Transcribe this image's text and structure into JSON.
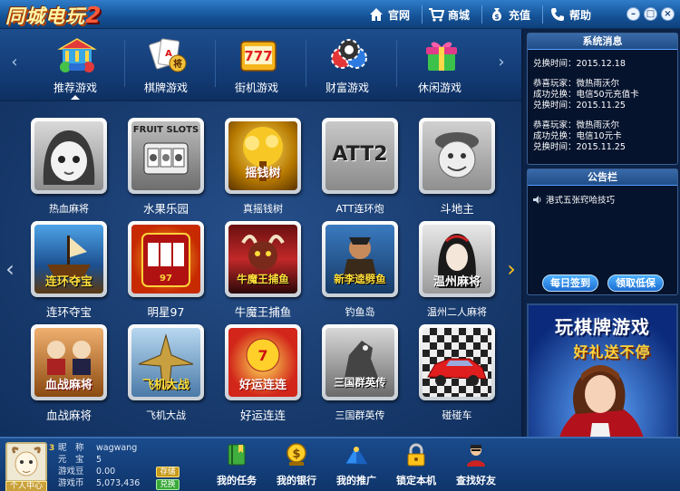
{
  "app": {
    "logo_text": "同城电玩",
    "logo_number": "2"
  },
  "titlebar": {
    "links": [
      {
        "label": "官网",
        "icon": "home-icon"
      },
      {
        "label": "商城",
        "icon": "shopping-cart-icon"
      },
      {
        "label": "充值",
        "icon": "money-bag-icon"
      },
      {
        "label": "帮助",
        "icon": "phone-icon"
      }
    ],
    "window_buttons": {
      "minimize": "–",
      "restore": "□",
      "close": "×"
    }
  },
  "categories": {
    "items": [
      {
        "label": "推荐游戏",
        "icon": "carousel-icon",
        "selected": true
      },
      {
        "label": "棋牌游戏",
        "icon": "playing-cards-icon",
        "selected": false
      },
      {
        "label": "街机游戏",
        "icon": "slot-777-icon",
        "selected": false
      },
      {
        "label": "财富游戏",
        "icon": "casino-chips-icon",
        "selected": false
      },
      {
        "label": "休闲游戏",
        "icon": "gift-box-icon",
        "selected": false
      }
    ],
    "prev": "‹",
    "next": "›"
  },
  "games": [
    {
      "label": "热血麻将",
      "art_text": "",
      "large": false
    },
    {
      "label": "水果乐园",
      "art_text": "FRUIT SLOTS",
      "large": true
    },
    {
      "label": "真摇钱树",
      "art_text": "摇钱树",
      "large": false
    },
    {
      "label": "ATT连环炮",
      "art_text": "ATT2",
      "large": false
    },
    {
      "label": "斗地主",
      "art_text": "",
      "large": true
    },
    {
      "label": "连环夺宝",
      "art_text": "连环夺宝",
      "large": true
    },
    {
      "label": "明星97",
      "art_text": "",
      "large": true
    },
    {
      "label": "牛魔王捕鱼",
      "art_text": "牛魔王捕鱼",
      "large": true
    },
    {
      "label": "钓鱼岛",
      "art_text": "新李逵劈鱼",
      "large": false
    },
    {
      "label": "温州二人麻将",
      "art_text": "温州麻将",
      "large": false
    },
    {
      "label": "血战麻将",
      "art_text": "血战麻将",
      "large": true
    },
    {
      "label": "飞机大战",
      "art_text": "飞机大战",
      "large": false
    },
    {
      "label": "好运连连",
      "art_text": "好运连连",
      "large": true
    },
    {
      "label": "三国群英传",
      "art_text": "三国群英传",
      "large": false
    },
    {
      "label": "碰碰车",
      "art_text": "",
      "large": false
    }
  ],
  "grid_nav": {
    "prev": "‹",
    "next": "›"
  },
  "system_messages": {
    "title": "系统消息",
    "lines": [
      "兑换时间：2015.12.18",
      "",
      "恭喜玩家：微热雨沃尔",
      "成功兑换：电信50元充值卡",
      "兑换时间：2015.11.25",
      "",
      "恭喜玩家：微热雨沃尔",
      "成功兑换：电信10元卡",
      "兑换时间：2015.11.25"
    ]
  },
  "notice_board": {
    "title": "公告栏",
    "items": [
      "港式五张窍哈技巧"
    ],
    "daily_signin": "每日签到",
    "claim_insurance": "领取低保"
  },
  "advert": {
    "line1": "玩棋牌游戏",
    "line2": "好礼送不停"
  },
  "user": {
    "vip_level": "3",
    "personal_center": "个人中心",
    "rows": [
      {
        "label": "昵　称",
        "value": "wagwang"
      },
      {
        "label": "元　宝",
        "value": "5"
      },
      {
        "label": "游戏豆",
        "value": "0.00"
      },
      {
        "label": "游戏币",
        "value": "5,073,436"
      }
    ],
    "deposit_button": "存储",
    "exchange_button": "兑换"
  },
  "bottom_nav": [
    {
      "label": "我的任务",
      "icon": "task-book-icon"
    },
    {
      "label": "我的银行",
      "icon": "bank-coin-icon"
    },
    {
      "label": "我的推广",
      "icon": "pyramid-icon"
    },
    {
      "label": "锁定本机",
      "icon": "lock-icon"
    },
    {
      "label": "查找好友",
      "icon": "find-friend-icon"
    }
  ],
  "colors": {
    "accent_yellow": "#ffc21a",
    "panel_bg": "#0c2347",
    "pill_blue": "#1d6ed1"
  }
}
